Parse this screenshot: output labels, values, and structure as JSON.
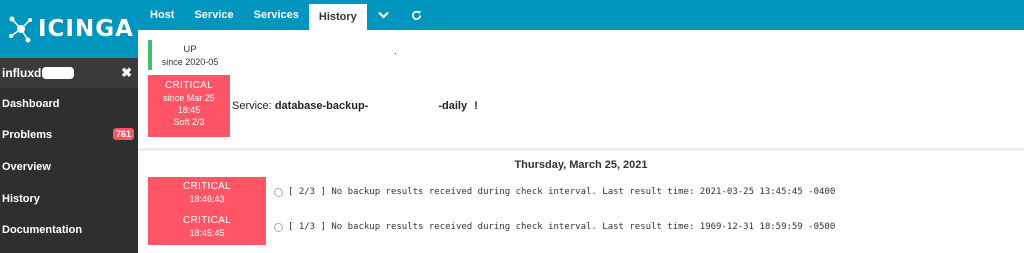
{
  "app": {
    "logo_text": "ICINGA"
  },
  "sidebar": {
    "search_value": "influxd",
    "items": [
      {
        "label": "Dashboard",
        "badge": ""
      },
      {
        "label": "Problems",
        "badge": "761"
      },
      {
        "label": "Overview",
        "badge": ""
      },
      {
        "label": "History",
        "badge": ""
      },
      {
        "label": "Documentation",
        "badge": ""
      }
    ]
  },
  "tabs": [
    {
      "label": "Host",
      "active": false
    },
    {
      "label": "Service",
      "active": false
    },
    {
      "label": "Services",
      "active": false
    },
    {
      "label": "History",
      "active": true
    }
  ],
  "tab_icons": [
    "chevron-down-icon",
    "refresh-icon"
  ],
  "host": {
    "state": "UP",
    "since": "since 2020-05",
    "name_suffix": "."
  },
  "service": {
    "state": "CRITICAL",
    "since": "since Mar 25",
    "time": "18:45",
    "attempt": "Soft 2/3",
    "prefix": "Service:",
    "name_start": "database-backup-",
    "name_end": "-daily",
    "flag": "!"
  },
  "history": {
    "date_heading": "Thursday, March 25, 2021",
    "events": [
      {
        "state": "CRITICAL",
        "time": "18:46:43",
        "output": "[ 2/3 ] No backup results received during check interval. Last result time: 2021-03-25 13:45:45 -0400"
      },
      {
        "state": "CRITICAL",
        "time": "18:45:45",
        "output": "[ 1/3 ] No backup results received during check interval. Last result time: 1969-12-31 18:59:59 -0500"
      }
    ]
  },
  "colors": {
    "brand": "#0095bf",
    "critical": "#ff5566",
    "ok": "#44bb77",
    "sidebar": "#2f2f2f"
  }
}
